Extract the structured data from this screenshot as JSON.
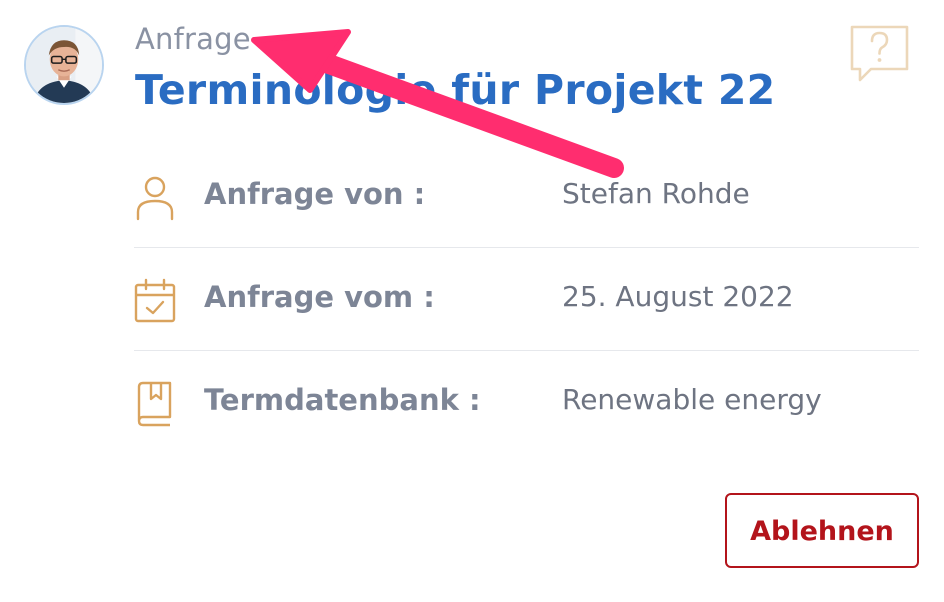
{
  "header": {
    "eyebrow": "Anfrage",
    "title": "Terminologie für Projekt 22"
  },
  "details": [
    {
      "icon": "person-icon",
      "label": "Anfrage von :",
      "value": "Stefan Rohde"
    },
    {
      "icon": "calendar-check-icon",
      "label": "Anfrage vom :",
      "value": "25. August 2022"
    },
    {
      "icon": "book-bookmark-icon",
      "label": "Termdatenbank :",
      "value": "Renewable energy"
    }
  ],
  "actions": {
    "reject_label": "Ablehnen"
  },
  "colors": {
    "title": "#2a6cc2",
    "icon_accent": "#d9a35e",
    "reject": "#b3141b",
    "annotation_arrow": "#ff2d6f"
  }
}
